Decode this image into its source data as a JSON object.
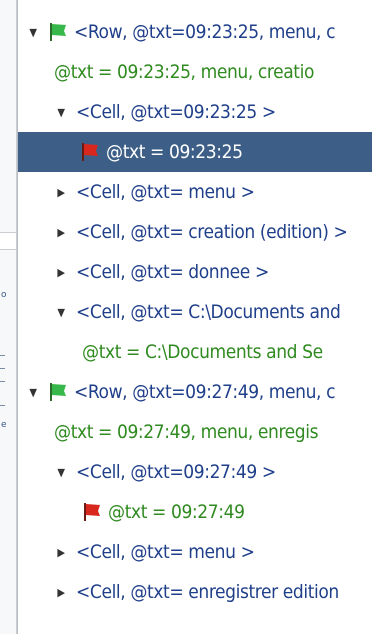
{
  "colors": {
    "element_text": "#1f3f8a",
    "attribute_text": "#2f8a1f",
    "selection_bg": "#3d5f87",
    "flag_green": "#37b84a",
    "flag_red": "#d8281d"
  },
  "left_strip": {
    "fragment_a": "o",
    "fragment_b": "e"
  },
  "tree": {
    "nodes": [
      {
        "type": "element",
        "arrow": "expanded",
        "icon": "green-flag-icon",
        "text": "<Row, @txt=09:23:25, menu, c"
      },
      {
        "type": "attribute",
        "arrow": "none",
        "icon": "none",
        "text": "@txt = 09:23:25, menu, creatio"
      },
      {
        "type": "element",
        "arrow": "expanded",
        "icon": "none",
        "text": "<Cell, @txt=09:23:25 >"
      },
      {
        "type": "attribute",
        "arrow": "none",
        "icon": "red-flag-icon",
        "text": "@txt = 09:23:25",
        "selected": true
      },
      {
        "type": "element",
        "arrow": "collapsed",
        "icon": "none",
        "text": "<Cell, @txt= menu >"
      },
      {
        "type": "element",
        "arrow": "collapsed",
        "icon": "none",
        "text": "<Cell, @txt= creation (edition) >"
      },
      {
        "type": "element",
        "arrow": "collapsed",
        "icon": "none",
        "text": "<Cell, @txt= donnee >"
      },
      {
        "type": "element",
        "arrow": "expanded",
        "icon": "none",
        "text": "<Cell, @txt= C:\\Documents and"
      },
      {
        "type": "attribute",
        "arrow": "none",
        "icon": "none",
        "text": "@txt =  C:\\Documents and Se"
      },
      {
        "type": "element",
        "arrow": "expanded",
        "icon": "green-flag-icon",
        "text": "<Row, @txt=09:27:49, menu, c"
      },
      {
        "type": "attribute",
        "arrow": "none",
        "icon": "none",
        "text": "@txt = 09:27:49, menu, enregis"
      },
      {
        "type": "element",
        "arrow": "expanded",
        "icon": "none",
        "text": "<Cell, @txt=09:27:49 >"
      },
      {
        "type": "attribute",
        "arrow": "none",
        "icon": "red-flag-icon",
        "text": "@txt = 09:27:49"
      },
      {
        "type": "element",
        "arrow": "collapsed",
        "icon": "none",
        "text": "<Cell, @txt= menu >"
      },
      {
        "type": "element",
        "arrow": "collapsed",
        "icon": "none",
        "text": "<Cell, @txt= enregistrer edition"
      }
    ]
  }
}
